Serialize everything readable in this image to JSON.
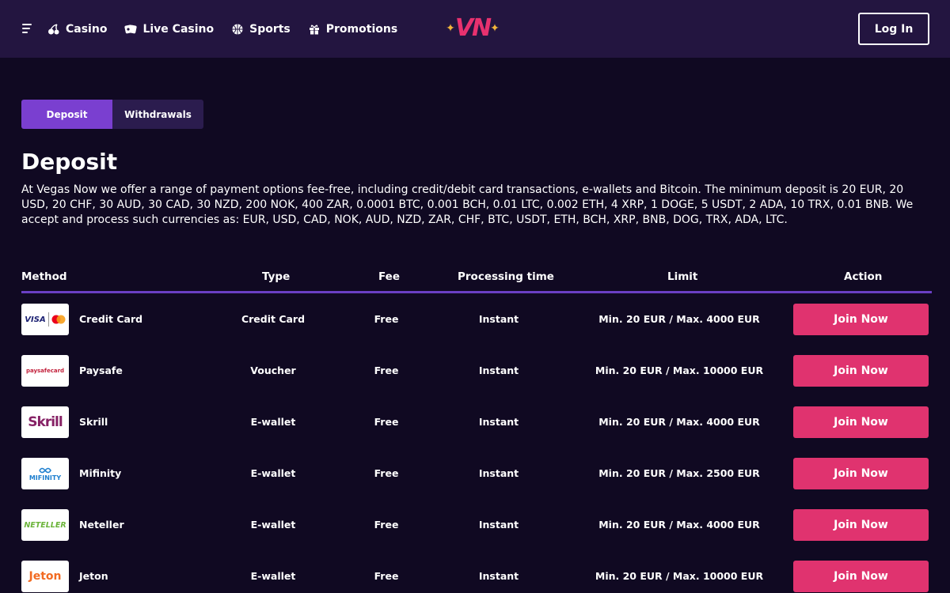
{
  "header": {
    "nav": [
      {
        "label": "Casino",
        "icon": "cherries-icon"
      },
      {
        "label": "Live Casino",
        "icon": "live-casino-icon"
      },
      {
        "label": "Sports",
        "icon": "basketball-icon"
      },
      {
        "label": "Promotions",
        "icon": "gift-icon"
      }
    ],
    "logo": "VN",
    "login_label": "Log In"
  },
  "tabs": [
    {
      "label": "Deposit",
      "active": true
    },
    {
      "label": "Withdrawals",
      "active": false
    }
  ],
  "page": {
    "title": "Deposit",
    "description": "At Vegas Now we offer a range of payment options fee-free, including credit/debit card transactions, e-wallets and Bitcoin. The minimum deposit is 20 EUR, 20 USD, 20 CHF, 30 AUD, 30 CAD, 30 NZD, 200 NOK, 400 ZAR, 0.0001 BTC, 0.001 BCH, 0.01 LTC, 0.002 ETH, 4 XRP, 1 DOGE, 5 USDT, 2 ADA, 10 TRX, 0.01 BNB. We accept and process such currencies as: EUR, USD, CAD, NOK, AUD, NZD, ZAR, CHF, BTC, USDT, ETH, BCH, XRP, BNB, DOG, TRX, ADA, LTC."
  },
  "table": {
    "headers": [
      "Method",
      "Type",
      "Fee",
      "Processing time",
      "Limit",
      "Action"
    ],
    "rows": [
      {
        "method": "Credit Card",
        "type": "Credit Card",
        "fee": "Free",
        "processing": "Instant",
        "limit": "Min. 20 EUR / Max. 4000 EUR",
        "action": "Join Now",
        "logo_text": "VISA"
      },
      {
        "method": "Paysafe",
        "type": "Voucher",
        "fee": "Free",
        "processing": "Instant",
        "limit": "Min. 20 EUR / Max. 10000 EUR",
        "action": "Join Now",
        "logo_text": "paysafecard"
      },
      {
        "method": "Skrill",
        "type": "E-wallet",
        "fee": "Free",
        "processing": "Instant",
        "limit": "Min. 20 EUR / Max. 4000 EUR",
        "action": "Join Now",
        "logo_text": "Skrill"
      },
      {
        "method": "Mifinity",
        "type": "E-wallet",
        "fee": "Free",
        "processing": "Instant",
        "limit": "Min. 20 EUR / Max. 2500 EUR",
        "action": "Join Now",
        "logo_text": "MIFINITY"
      },
      {
        "method": "Neteller",
        "type": "E-wallet",
        "fee": "Free",
        "processing": "Instant",
        "limit": "Min. 20 EUR / Max. 4000 EUR",
        "action": "Join Now",
        "logo_text": "NETELLER"
      },
      {
        "method": "Jeton",
        "type": "E-wallet",
        "fee": "Free",
        "processing": "Instant",
        "limit": "Min. 20 EUR / Max. 10000 EUR",
        "action": "Join Now",
        "logo_text": "Jeton"
      }
    ]
  },
  "colors": {
    "background": "#100922",
    "header": "#231540",
    "accent_purple": "#7a3fd0",
    "join_pink": "#e0336f",
    "logo_gold": "#f2b53a"
  }
}
